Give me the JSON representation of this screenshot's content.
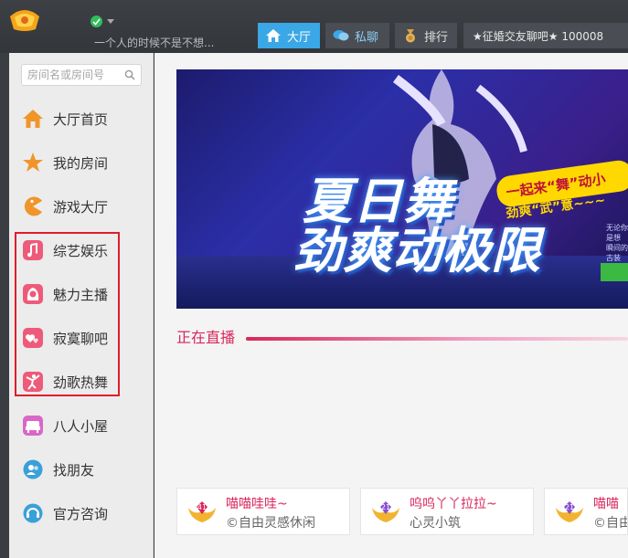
{
  "header": {
    "signature": "一个人的时候不是不想...",
    "tabs": [
      {
        "label": "大厅",
        "icon": "home-icon",
        "active": true
      },
      {
        "label": "私聊",
        "icon": "chat-bubbles-icon",
        "active": false
      },
      {
        "label": "排行",
        "icon": "medal-icon",
        "active": false
      }
    ],
    "room_display": "★征婚交友聊吧★ 100008"
  },
  "search": {
    "placeholder": "房间名或房间号"
  },
  "sidebar": {
    "items": [
      {
        "label": "大厅首页",
        "icon": "house-icon",
        "color": "#f0952a"
      },
      {
        "label": "我的房间",
        "icon": "star-icon",
        "color": "#f0952a"
      },
      {
        "label": "游戏大厅",
        "icon": "pacman-icon",
        "color": "#f0952a"
      },
      {
        "label": "综艺娱乐",
        "icon": "music-note-icon",
        "color": "#ee5a79"
      },
      {
        "label": "魅力主播",
        "icon": "woman-icon",
        "color": "#ee5a79"
      },
      {
        "label": "寂寞聊吧",
        "icon": "hearts-icon",
        "color": "#ee5a79"
      },
      {
        "label": "劲歌热舞",
        "icon": "dancer-icon",
        "color": "#ee5a79"
      },
      {
        "label": "八人小屋",
        "icon": "sofa-icon",
        "color": "#d868c8"
      },
      {
        "label": "找朋友",
        "icon": "friends-icon",
        "color": "#3aa0d8"
      },
      {
        "label": "官方咨询",
        "icon": "headset-icon",
        "color": "#3aa0d8"
      }
    ]
  },
  "banner": {
    "title_line1": "夏日舞",
    "title_line2": "劲爽动极限",
    "slogan": "一起来“舞”动小",
    "sub_slogan": "劲爽“武”意~~~",
    "small_text": "无论你是想 瞬间的古装 瞬间爱了各种"
  },
  "live": {
    "title": "正在直播",
    "rooms": [
      {
        "name": "喵喵哇哇~",
        "sub": "©自由灵感休闲",
        "level": "41"
      },
      {
        "name": "呜呜丫丫拉拉~",
        "sub": "心灵小筑",
        "level": "21"
      },
      {
        "name": "喵喵",
        "sub": "©自由",
        "level": "21"
      }
    ]
  },
  "colors": {
    "accent": "#3aa7e6",
    "live_pink": "#d9265b",
    "highlight_red": "#e01c2a"
  }
}
